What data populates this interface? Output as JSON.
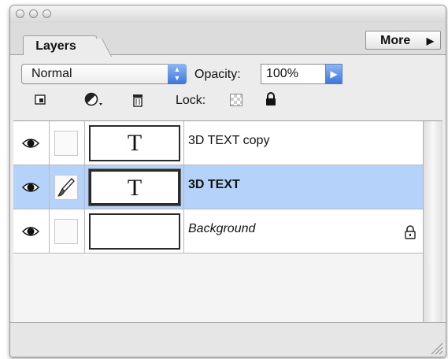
{
  "panel": {
    "tab_label": "Layers",
    "more_label": "More",
    "more_arrow": "▶"
  },
  "controls": {
    "blend_mode": "Normal",
    "opacity_label": "Opacity:",
    "opacity_value": "100%",
    "lock_label": "Lock:"
  },
  "icons": {
    "tools": [
      "merge-layers-icon",
      "adjustment-layer-icon",
      "trash-icon"
    ],
    "lock": [
      "lock-transparency-icon",
      "lock-all-icon"
    ],
    "row": [
      "eye-icon",
      "paintbrush-icon",
      "lock-icon"
    ]
  },
  "layers": [
    {
      "name": "3D TEXT copy",
      "thumb": "T",
      "selected": false,
      "visible": true,
      "brush": false,
      "locked": false
    },
    {
      "name": "3D TEXT",
      "thumb": "T",
      "selected": true,
      "visible": true,
      "brush": true,
      "locked": false
    },
    {
      "name": "Background",
      "thumb": "",
      "selected": false,
      "visible": true,
      "brush": false,
      "locked": true
    }
  ]
}
